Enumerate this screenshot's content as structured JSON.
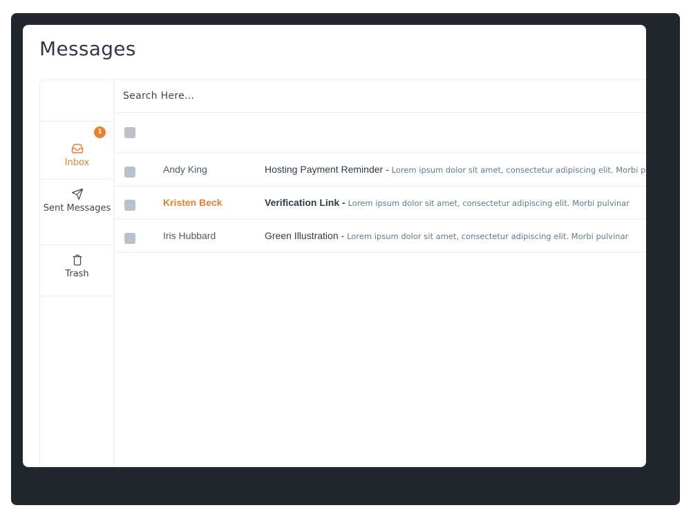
{
  "page": {
    "title": "Messages"
  },
  "sidebar": {
    "items": [
      {
        "label": "Inbox",
        "icon": "inbox-icon",
        "badge": "1",
        "active": true
      },
      {
        "label": "Sent Messages",
        "icon": "send-icon"
      },
      {
        "label": "Trash",
        "icon": "trash-icon"
      }
    ]
  },
  "search": {
    "placeholder": "Search Here..."
  },
  "messages": [
    {
      "sender": "Andy King",
      "subject": "Hosting Payment Reminder",
      "separator": " - ",
      "preview": "Lorem ipsum dolor sit amet, consectetur adipiscing elit. Morbi pulvinar",
      "unread": false
    },
    {
      "sender": "Kristen Beck",
      "subject": "Verification Link",
      "separator": " - ",
      "preview": "Lorem ipsum dolor sit amet, consectetur adipiscing elit. Morbi pulvinar",
      "unread": true
    },
    {
      "sender": "Iris Hubbard",
      "subject": "Green Illustration",
      "separator": " - ",
      "preview": "Lorem ipsum dolor sit amet, consectetur adipiscing elit. Morbi pulvinar",
      "unread": false
    }
  ],
  "colors": {
    "accent": "#ee7f2d",
    "frame": "#22262d",
    "checkbox": "#b9c1cb",
    "preview_text": "#5e7a8f"
  }
}
